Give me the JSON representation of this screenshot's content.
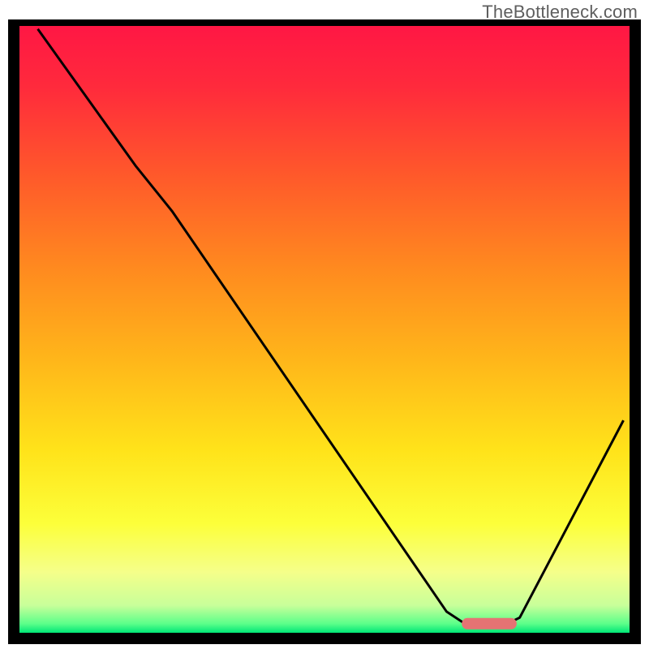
{
  "watermark": "TheBottleneck.com",
  "chart_data": {
    "type": "line",
    "title": "",
    "xlabel": "",
    "ylabel": "",
    "xlim": [
      0,
      100
    ],
    "ylim": [
      0,
      100
    ],
    "grid": false,
    "legend": false,
    "axes_visible": false,
    "gradient_stops": [
      {
        "offset": 0.0,
        "color": "#ff1744"
      },
      {
        "offset": 0.1,
        "color": "#ff2a3c"
      },
      {
        "offset": 0.25,
        "color": "#ff5a2a"
      },
      {
        "offset": 0.4,
        "color": "#ff8a1f"
      },
      {
        "offset": 0.55,
        "color": "#ffb61a"
      },
      {
        "offset": 0.7,
        "color": "#ffe31a"
      },
      {
        "offset": 0.82,
        "color": "#fcff3a"
      },
      {
        "offset": 0.9,
        "color": "#f5ff8a"
      },
      {
        "offset": 0.955,
        "color": "#c8ff9a"
      },
      {
        "offset": 0.985,
        "color": "#5cff8a"
      },
      {
        "offset": 1.0,
        "color": "#00e676"
      }
    ],
    "series": [
      {
        "name": "bottleneck-curve",
        "stroke": "#000000",
        "points": [
          {
            "x": 3.0,
            "y": 99.5
          },
          {
            "x": 19.0,
            "y": 77.0
          },
          {
            "x": 25.0,
            "y": 69.5
          },
          {
            "x": 70.0,
            "y": 3.5
          },
          {
            "x": 73.0,
            "y": 1.5
          },
          {
            "x": 80.0,
            "y": 1.5
          },
          {
            "x": 82.0,
            "y": 2.5
          },
          {
            "x": 99.0,
            "y": 35.0
          }
        ]
      }
    ],
    "marker": {
      "name": "optimal-marker",
      "x_center": 77.0,
      "width": 9.0,
      "y": 1.5,
      "color": "#e57373"
    }
  },
  "plot": {
    "outer_x": 10,
    "outer_y": 24,
    "outer_w": 780,
    "outer_h": 770,
    "inner_x": 24,
    "inner_y": 32,
    "inner_w": 752,
    "inner_h": 748
  }
}
